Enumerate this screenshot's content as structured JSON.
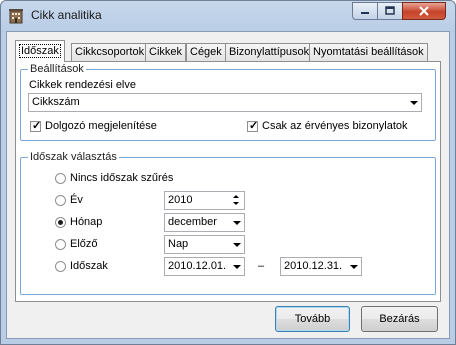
{
  "window": {
    "title": "Cikk analitika",
    "app_icon": "building-icon"
  },
  "tabs": [
    {
      "label": "Időszak",
      "active": true
    },
    {
      "label": "Cikkcsoportok"
    },
    {
      "label": "Cikkek"
    },
    {
      "label": "Cégek"
    },
    {
      "label": "Bizonylattípusok"
    },
    {
      "label": "Nyomtatási beállítások"
    }
  ],
  "settings": {
    "legend": "Beállítások",
    "sort_label": "Cikkek rendezési elve",
    "sort_value": "Cikkszám",
    "show_employee_label": "Dolgozó megjelenítése",
    "show_employee_checked": true,
    "valid_docs_label": "Csak az érvényes bizonylatok",
    "valid_docs_checked": true
  },
  "period": {
    "legend": "Időszak választás",
    "options": {
      "none": "Nincs időszak szűrés",
      "year": "Év",
      "month": "Hónap",
      "previous": "Előző",
      "range": "Időszak"
    },
    "selected": "month",
    "year_value": "2010",
    "month_value": "december",
    "previous_value": "Nap",
    "range_from": "2010.12.01.",
    "range_separator": "–",
    "range_to": "2010.12.31."
  },
  "buttons": {
    "next": "Tovább",
    "close": "Bezárás"
  }
}
